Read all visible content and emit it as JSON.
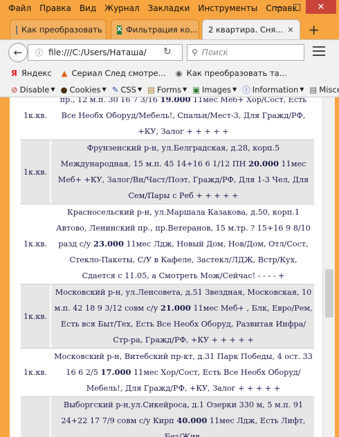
{
  "menu": [
    "Файл",
    "Правка",
    "Вид",
    "Журнал",
    "Закладки",
    "Инструменты",
    "Справк"
  ],
  "window_controls": {
    "minimize": "—",
    "maximize": "□",
    "close": "✕"
  },
  "tabs": [
    {
      "label": "Как преобразовать ...",
      "icon": "page-icon"
    },
    {
      "label": "Фильтрация ко...",
      "icon": "excel-icon"
    },
    {
      "label": "2 квартира. Сня...",
      "icon": "",
      "active": true,
      "close": "✕"
    }
  ],
  "new_tab": "+",
  "url": "file:///C:/Users/Наташа/",
  "search_placeholder": "Поиск",
  "bookmarks": [
    {
      "icon": "Я",
      "label": "Яндекс"
    },
    {
      "icon": "▲",
      "label": "Сериал След смотре..."
    },
    {
      "icon": "◉",
      "label": "Как преобразовать та..."
    }
  ],
  "devbar": [
    {
      "icon": "⊘",
      "label": "Disable"
    },
    {
      "icon": "●",
      "label": "Cookies"
    },
    {
      "icon": "✎",
      "label": "CSS"
    },
    {
      "icon": "▤",
      "label": "Forms"
    },
    {
      "icon": "▣",
      "label": "Images"
    },
    {
      "icon": "ⓘ",
      "label": "Information"
    },
    {
      "icon": "▤",
      "label": "Misce"
    }
  ],
  "rows": [
    {
      "grey": false,
      "type": "1к.кв.",
      "pre": "пр., 12 м.п. 30 16 7 3/16",
      "price": "19.000",
      "post": "11мес Меб+  Хор/Сост, Есть Все Необх Оборуд/Мебель!, Спальн/Мест-3, Для Гражд/РФ, +КУ, Залог     + + + + +"
    },
    {
      "grey": true,
      "type": "1к.кв.",
      "pre": "Фрунзенский р-н, ул.Белградская, д.28, корп.5 Международная, 15 м.п. 45 14+16 6 1/12    ПН",
      "price": "20.000",
      "post": "11мес Меб+  +КУ, Залог/Вн/Част/Поэт, Гражд/РФ, Для 1-3 Чел, Для Сем/Пары с Реб      + + + + +"
    },
    {
      "grey": false,
      "type": "1к.кв.",
      "pre": "Красносельский р-н, ул.Маршала Казакова, д.50, корп.1 Автово, Ленинский пр., пр.Ветеранов, 15 м.тр. ? 15+16 9 8/10 разд с/у",
      "price": "23.000",
      "post": "11мес Лдж, Новый Дом, Нов/Дом, Отл/Сост, Стекло-Пакеты, С/У в Кафеле, Застекл/ЛДЖ, Встр/Кух, Сдается с 11.05, а Смотреть Мож/Сейчас!       - - - - +"
    },
    {
      "grey": true,
      "type": "1к.кв.",
      "pre": "Московский р-н, ул.Ленсовета, д.51 Звездная, Московская, 10 м.п. 42 18 9 3/12 совм с/у",
      "price": "21.000",
      "post": "11мес Меб+ , Блк, Евро/Рем, Есть вся Быт/Тех, Есть Все Необх Оборуд, Развитая Инфра/Стр-ра, Гражд/РФ, +КУ       + + + + +"
    },
    {
      "grey": false,
      "type": "1к.кв.",
      "pre": "Московский р-н, Витебский пр-кт, д.31 Парк Победы, 4 ост. 33 16 6 2/5",
      "price": "17.000",
      "post": "11мес Хор/Сост, Есть Все Необх Оборуд/Мебель!, Для Гражд/РФ, +КУ, Залог       + + + + +"
    },
    {
      "grey": true,
      "type": "",
      "pre": "Выборгский р-н,ул.Сикейроса, д.1 Озерки 330 м, 5 м.п. 91 24+22 17 7/9 совм с/у Кирп",
      "price": "40.000",
      "post": "11мес Лдж, Есть Лифт, Без/Жив,"
    }
  ]
}
